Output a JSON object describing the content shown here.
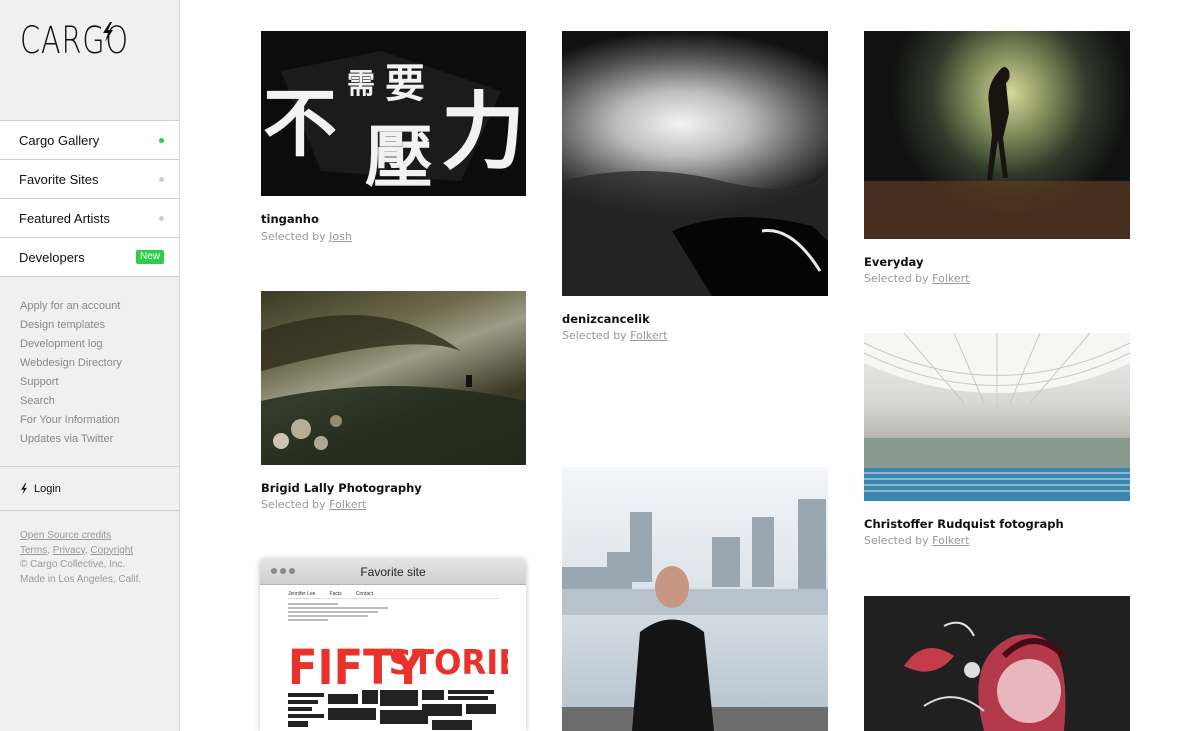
{
  "brand": {
    "logo_text": "CARGO"
  },
  "sidebar": {
    "nav": [
      {
        "label": "Cargo Gallery",
        "indicator": "dot-active"
      },
      {
        "label": "Favorite Sites",
        "indicator": "dot"
      },
      {
        "label": "Featured Artists",
        "indicator": "dot"
      },
      {
        "label": "Developers",
        "indicator": "badge",
        "badge": "New"
      }
    ],
    "links": [
      "Apply for an account",
      "Design templates",
      "Development log",
      "Webdesign Directory",
      "Support",
      "Search",
      "For Your Information",
      "Updates via Twitter"
    ],
    "login_label": "Login",
    "footer": {
      "open_source": "Open Source credits",
      "terms": "Terms",
      "privacy": "Privacy",
      "copyright": "Copyright",
      "sep1": ", ",
      "sep2": ", ",
      "company": "© Cargo Collective, Inc.",
      "made_in": "Made in Los Angeles, Calif."
    }
  },
  "gallery": {
    "selected_by_prefix": "Selected by ",
    "items": [
      {
        "title": "tinganho",
        "selected_by": "Josh",
        "image_text": [
          "不",
          "需",
          "要",
          "壓",
          "力"
        ]
      },
      {
        "title": "denizcancelik",
        "selected_by": "Folkert"
      },
      {
        "title": "Everyday",
        "selected_by": "Folkert"
      },
      {
        "title": "Brigid Lally Photography",
        "selected_by": "Folkert"
      },
      {
        "title": "Christoffer Rudquist fotograph",
        "selected_by": "Folkert"
      },
      {
        "window_title": "Favorite site",
        "nav_links": [
          "Jennifer Lee",
          "Facts",
          "Contact"
        ],
        "poster_words": [
          "FIFTY",
          "STORIES"
        ]
      },
      {
        "kind": "portrait"
      },
      {
        "kind": "illustration"
      }
    ]
  },
  "colors": {
    "accent_green": "#2ecc4b",
    "sidebar_bg": "#f0f0f0"
  }
}
